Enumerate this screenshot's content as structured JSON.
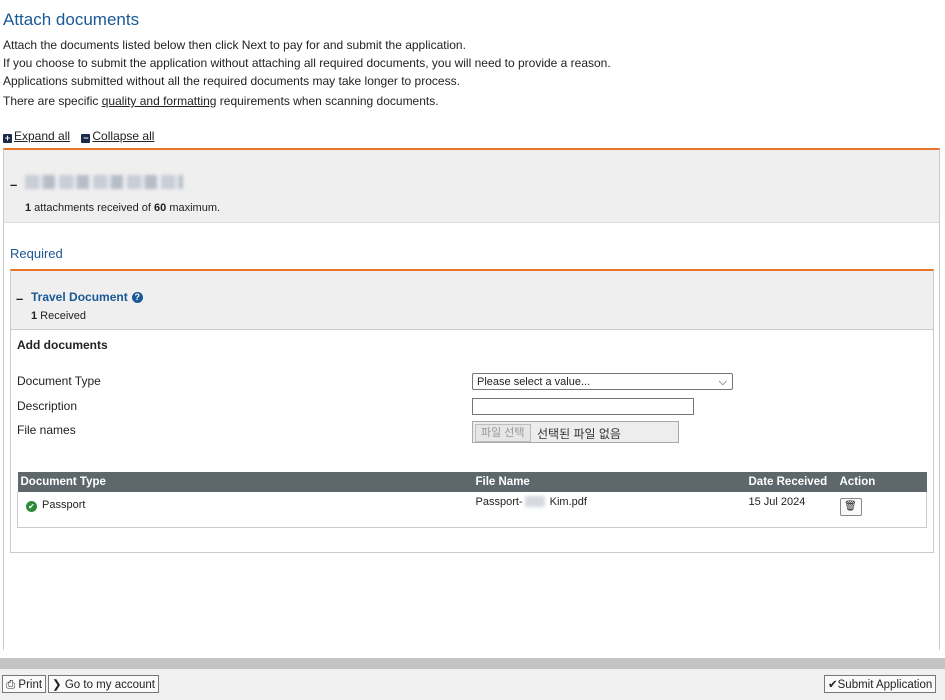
{
  "header": {
    "title": "Attach documents",
    "intro_lines": [
      "Attach the documents listed below then click Next to pay for and submit the application.",
      "If you choose to submit the application without attaching all required documents, you will need to provide a reason.",
      "Applications submitted without all the required documents may take longer to process."
    ],
    "quality_prefix": "There are specific ",
    "quality_link": "quality and formatting",
    "quality_suffix": " requirements when scanning documents."
  },
  "controls": {
    "expand_all": "Expand all",
    "collapse_all": "Collapse all"
  },
  "applicant": {
    "attachments_count": "1",
    "attachments_text": " attachments received of ",
    "attachments_max": "60",
    "attachments_suffix": " maximum."
  },
  "required_section": {
    "label": "Required",
    "document_title": "Travel Document",
    "received_count": "1",
    "received_text": " Received"
  },
  "add_documents": {
    "heading": "Add documents",
    "document_type_label": "Document Type",
    "document_type_value": "Please select a value...",
    "description_label": "Description",
    "description_value": "",
    "file_names_label": "File names",
    "file_button_label": "파일 선택",
    "file_none_text": "선택된 파일 없음"
  },
  "table": {
    "columns": [
      "Document Type",
      "File Name",
      "Date Received",
      "Action"
    ],
    "rows": [
      {
        "document_type": "Passport",
        "file_name_prefix": "Passport-",
        "file_name_suffix": " Kim.pdf",
        "date_received": "15 Jul 2024",
        "status": "received"
      }
    ]
  },
  "footer": {
    "print": "Print",
    "account": "Go to my account",
    "submit": "Submit Application"
  },
  "icons": {
    "expand": "plus-square-icon",
    "collapse": "minus-square-icon",
    "help": "question-circle-icon",
    "status": "check-circle-icon",
    "delete": "trash-icon",
    "print": "printer-icon",
    "account": "chevron-right-icon",
    "submit": "check-circle-outline-icon"
  },
  "colors": {
    "title_blue": "#1a5896",
    "accent_orange": "#e8762d",
    "table_header": "#5d676c",
    "status_green": "#2e8b3a"
  }
}
